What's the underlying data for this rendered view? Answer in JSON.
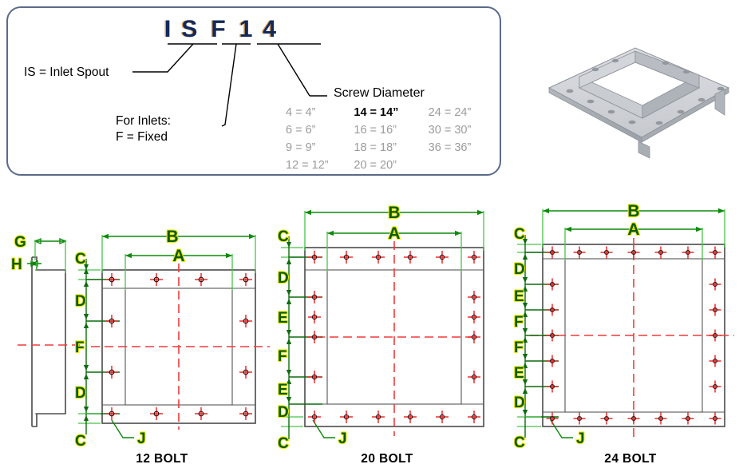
{
  "nomenclature": {
    "code_parts": [
      "I",
      "S",
      "F",
      "1",
      "4"
    ],
    "is_label": "IS = Inlet Spout",
    "for_inlets_line1": "For Inlets:",
    "for_inlets_line2": "F = Fixed",
    "screw_diameter_label": "Screw Diameter",
    "screw_diameter_table": [
      [
        "4 = 4”",
        "14 = 14”",
        "24 = 24”"
      ],
      [
        "6 = 6”",
        "16 = 16”",
        "30 = 30”"
      ],
      [
        "9 = 9”",
        "18 = 18”",
        "36 = 36”"
      ],
      [
        "12 = 12”",
        "20 = 20”",
        ""
      ]
    ],
    "highlighted_cell": "14 = 14”",
    "colors": {
      "panel_border": "#5a6a8c",
      "code_text": "#12295c",
      "code_shadow": "#d99a4e",
      "table_muted": "#9b9b9b"
    }
  },
  "product_image": {
    "alt": "isometric-inlet-spout-flange",
    "colors": {
      "face_light": "#d8dade",
      "face_mid": "#b8bcc2",
      "face_dark": "#8f949b"
    }
  },
  "side_view": {
    "dim_labels": [
      "G",
      "H"
    ]
  },
  "drawings": [
    {
      "id": "12-bolt",
      "title": "12 BOLT",
      "bolt_count": 12,
      "top_bolts": 4,
      "bottom_bolts": 4,
      "side_bolts_each": 2,
      "horizontal_dims": [
        "B",
        "A"
      ],
      "vertical_dims": [
        "C",
        "D",
        "F",
        "D",
        "C"
      ],
      "leader_label": "J"
    },
    {
      "id": "20-bolt",
      "title": "20 BOLT",
      "bolt_count": 20,
      "top_bolts": 6,
      "bottom_bolts": 6,
      "side_bolts_each": 4,
      "horizontal_dims": [
        "B",
        "A"
      ],
      "vertical_dims": [
        "C",
        "D",
        "E",
        "F",
        "E",
        "D",
        "C"
      ],
      "leader_label": "J"
    },
    {
      "id": "24-bolt",
      "title": "24 BOLT",
      "bolt_count": 24,
      "top_bolts": 7,
      "bottom_bolts": 7,
      "side_bolts_each": 5,
      "horizontal_dims": [
        "B",
        "A"
      ],
      "vertical_dims": [
        "C",
        "D",
        "E",
        "F",
        "F",
        "E",
        "D",
        "C"
      ],
      "leader_label": "J"
    }
  ],
  "colors": {
    "dimension_green": "#0c8a0c",
    "dimension_letter": "#0c5a0c",
    "letter_halo": "#e8e800",
    "centerline_red": "#ef3b3b",
    "bolt_red": "#ef2a2a",
    "part_gray": "#4a4a4a"
  }
}
